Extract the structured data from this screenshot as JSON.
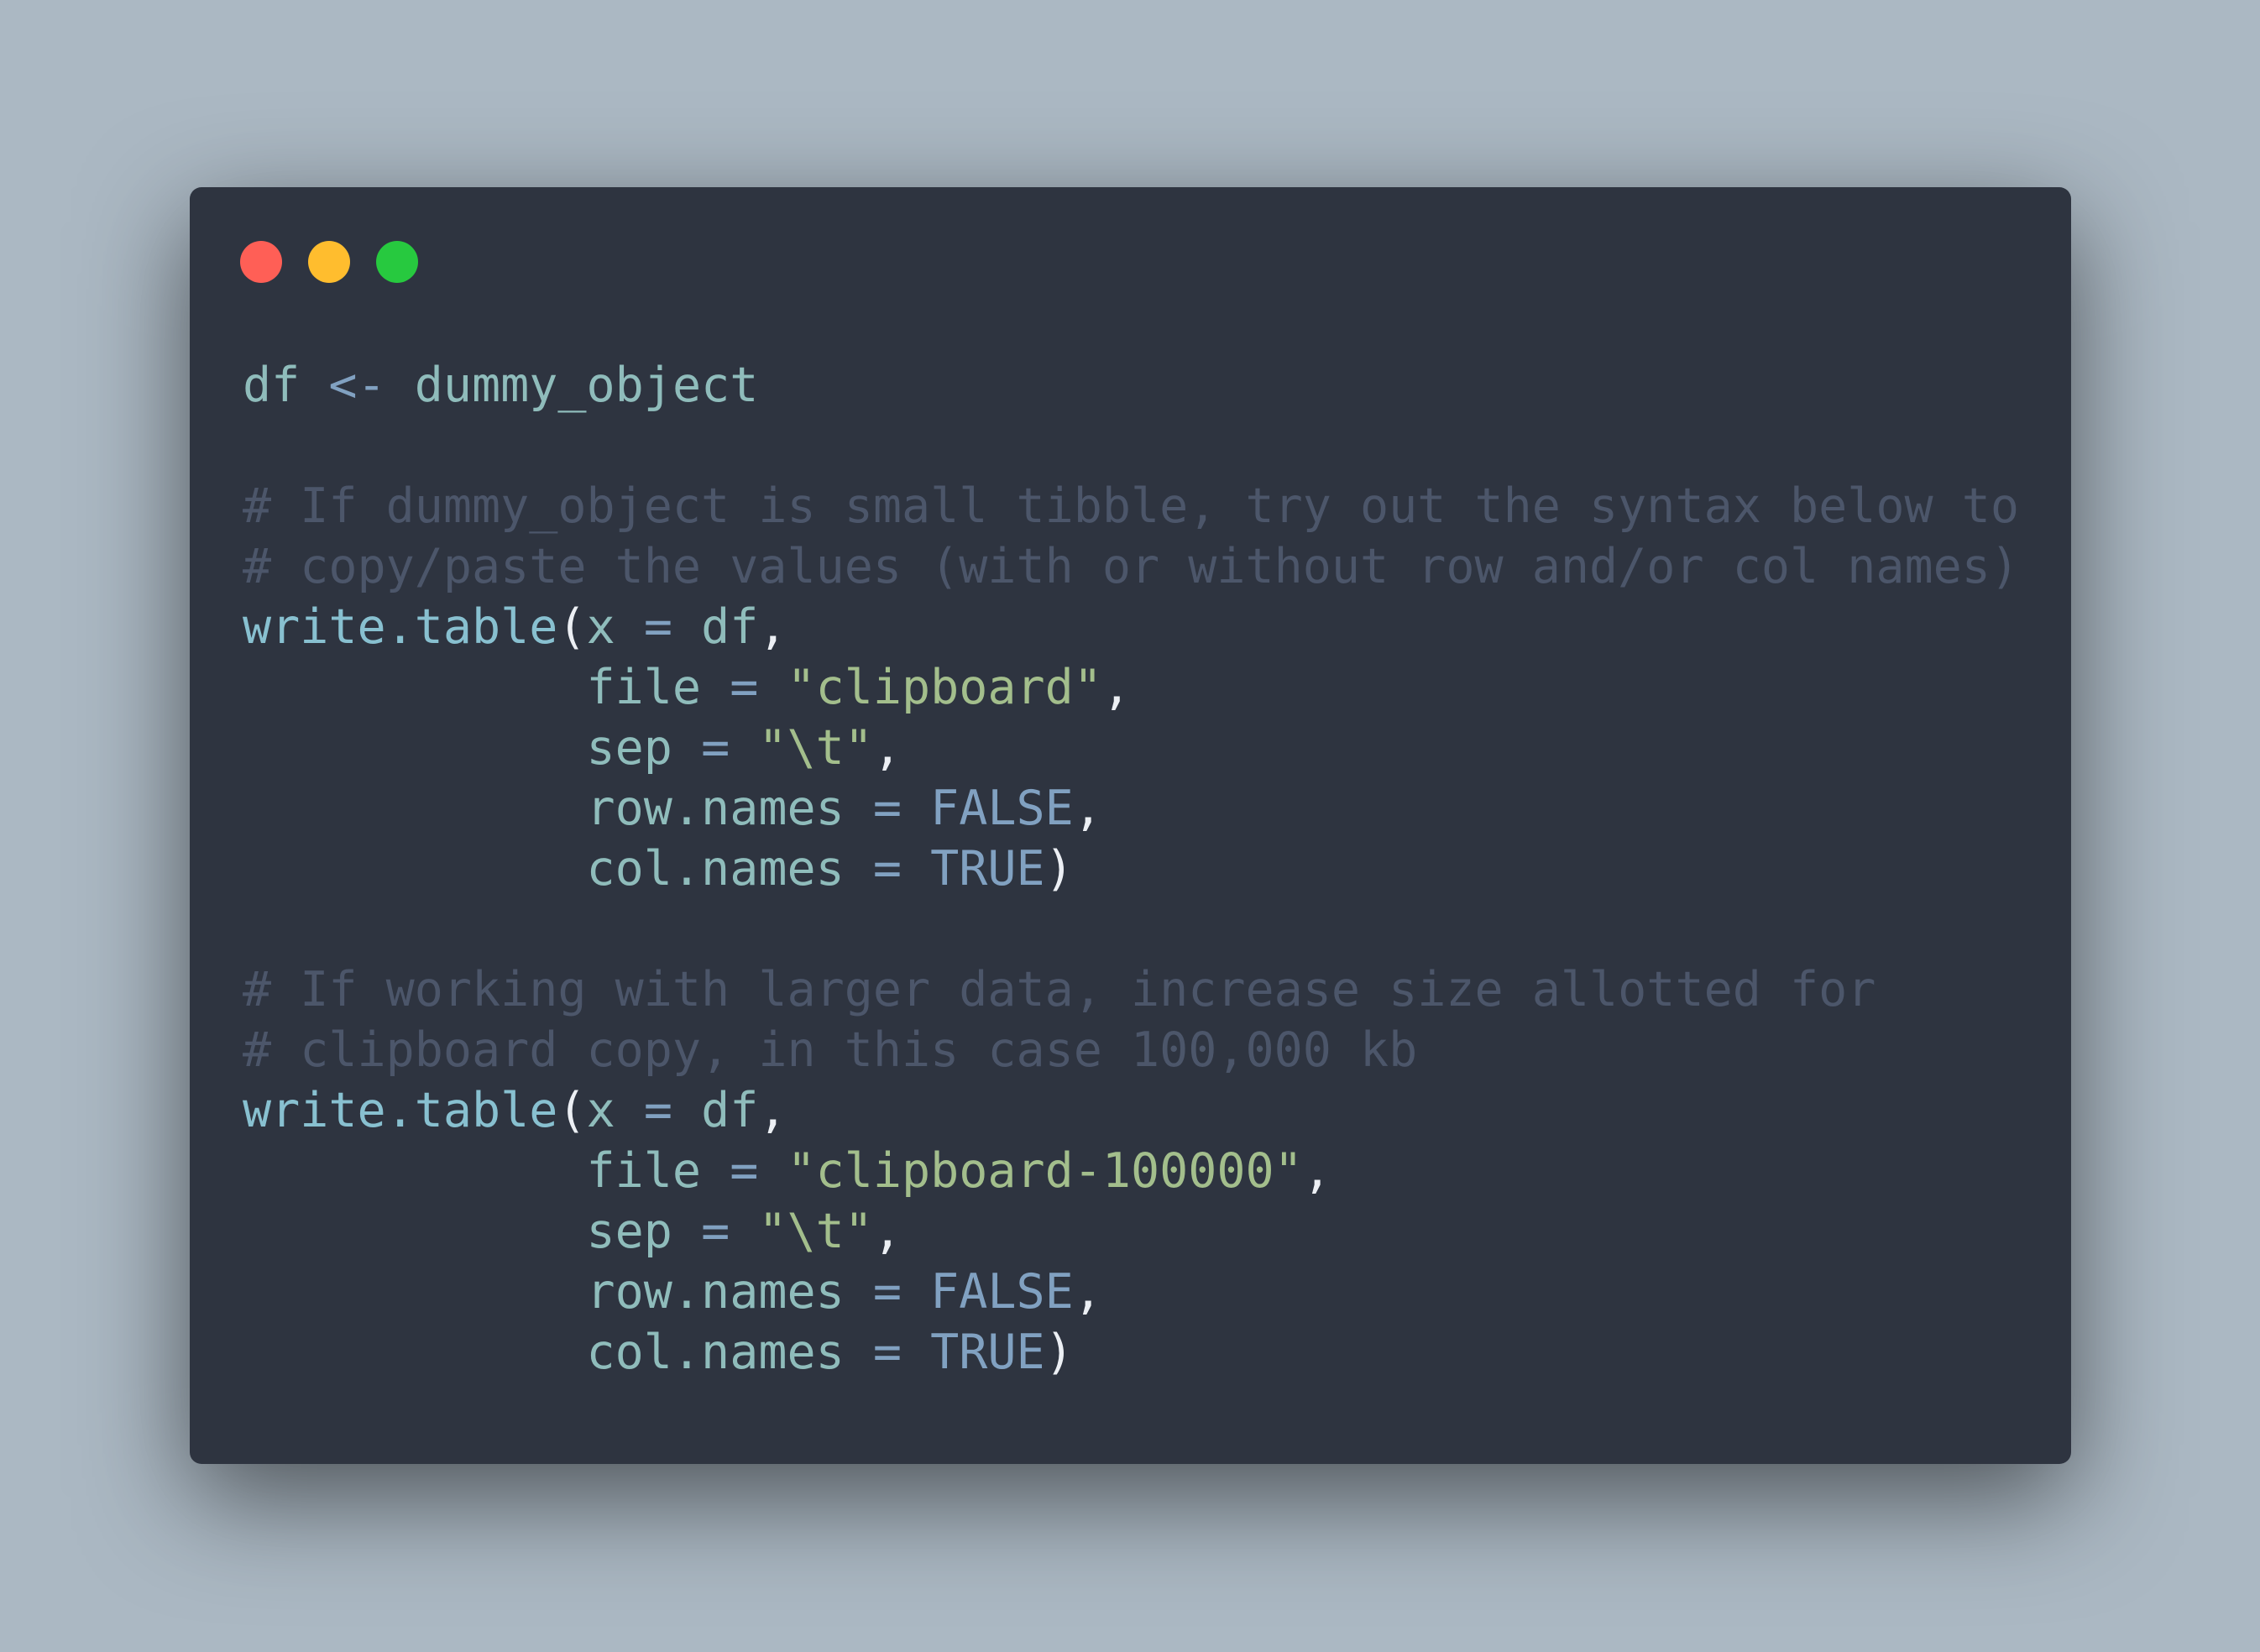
{
  "window": {
    "controls": [
      {
        "name": "close",
        "color": "#ff5f56"
      },
      {
        "name": "minimize",
        "color": "#ffbd2e"
      },
      {
        "name": "maximize",
        "color": "#27c93f"
      }
    ]
  },
  "code": {
    "language": "R",
    "lines": [
      [
        {
          "t": "id",
          "v": "df"
        },
        {
          "t": "op",
          "v": " <- "
        },
        {
          "t": "id",
          "v": "dummy_object"
        }
      ],
      [],
      [
        {
          "t": "comment",
          "v": "# If dummy_object is small tibble, try out the syntax below to"
        }
      ],
      [
        {
          "t": "comment",
          "v": "# copy/paste the values (with or without row and/or col names)"
        }
      ],
      [
        {
          "t": "fn",
          "v": "write.table"
        },
        {
          "t": "punc",
          "v": "("
        },
        {
          "t": "id",
          "v": "x"
        },
        {
          "t": "op",
          "v": " = "
        },
        {
          "t": "id",
          "v": "df"
        },
        {
          "t": "punc",
          "v": ","
        }
      ],
      [
        {
          "t": "plain",
          "v": "            "
        },
        {
          "t": "id",
          "v": "file"
        },
        {
          "t": "op",
          "v": " = "
        },
        {
          "t": "str",
          "v": "\"clipboard\""
        },
        {
          "t": "punc",
          "v": ","
        }
      ],
      [
        {
          "t": "plain",
          "v": "            "
        },
        {
          "t": "id",
          "v": "sep"
        },
        {
          "t": "op",
          "v": " = "
        },
        {
          "t": "str",
          "v": "\"\\t\""
        },
        {
          "t": "punc",
          "v": ","
        }
      ],
      [
        {
          "t": "plain",
          "v": "            "
        },
        {
          "t": "id",
          "v": "row.names"
        },
        {
          "t": "op",
          "v": " = "
        },
        {
          "t": "const",
          "v": "FALSE"
        },
        {
          "t": "punc",
          "v": ","
        }
      ],
      [
        {
          "t": "plain",
          "v": "            "
        },
        {
          "t": "id",
          "v": "col.names"
        },
        {
          "t": "op",
          "v": " = "
        },
        {
          "t": "const",
          "v": "TRUE"
        },
        {
          "t": "punc",
          "v": ")"
        }
      ],
      [],
      [
        {
          "t": "comment",
          "v": "# If working with larger data, increase size allotted for"
        }
      ],
      [
        {
          "t": "comment",
          "v": "# clipboard copy, in this case 100,000 kb"
        }
      ],
      [
        {
          "t": "fn",
          "v": "write.table"
        },
        {
          "t": "punc",
          "v": "("
        },
        {
          "t": "id",
          "v": "x"
        },
        {
          "t": "op",
          "v": " = "
        },
        {
          "t": "id",
          "v": "df"
        },
        {
          "t": "punc",
          "v": ","
        }
      ],
      [
        {
          "t": "plain",
          "v": "            "
        },
        {
          "t": "id",
          "v": "file"
        },
        {
          "t": "op",
          "v": " = "
        },
        {
          "t": "str",
          "v": "\"clipboard-100000\""
        },
        {
          "t": "punc",
          "v": ","
        }
      ],
      [
        {
          "t": "plain",
          "v": "            "
        },
        {
          "t": "id",
          "v": "sep"
        },
        {
          "t": "op",
          "v": " = "
        },
        {
          "t": "str",
          "v": "\"\\t\""
        },
        {
          "t": "punc",
          "v": ","
        }
      ],
      [
        {
          "t": "plain",
          "v": "            "
        },
        {
          "t": "id",
          "v": "row.names"
        },
        {
          "t": "op",
          "v": " = "
        },
        {
          "t": "const",
          "v": "FALSE"
        },
        {
          "t": "punc",
          "v": ","
        }
      ],
      [
        {
          "t": "plain",
          "v": "            "
        },
        {
          "t": "id",
          "v": "col.names"
        },
        {
          "t": "op",
          "v": " = "
        },
        {
          "t": "const",
          "v": "TRUE"
        },
        {
          "t": "punc",
          "v": ")"
        }
      ]
    ]
  },
  "colors": {
    "background": "#abb8c3",
    "editor_background": "#2e3440",
    "identifier": "#8fbcbb",
    "function": "#88c0d0",
    "operator": "#81a1c1",
    "string": "#a3be8c",
    "constant": "#81a1c1",
    "punctuation": "#eceff4",
    "comment": "#4c566a"
  }
}
